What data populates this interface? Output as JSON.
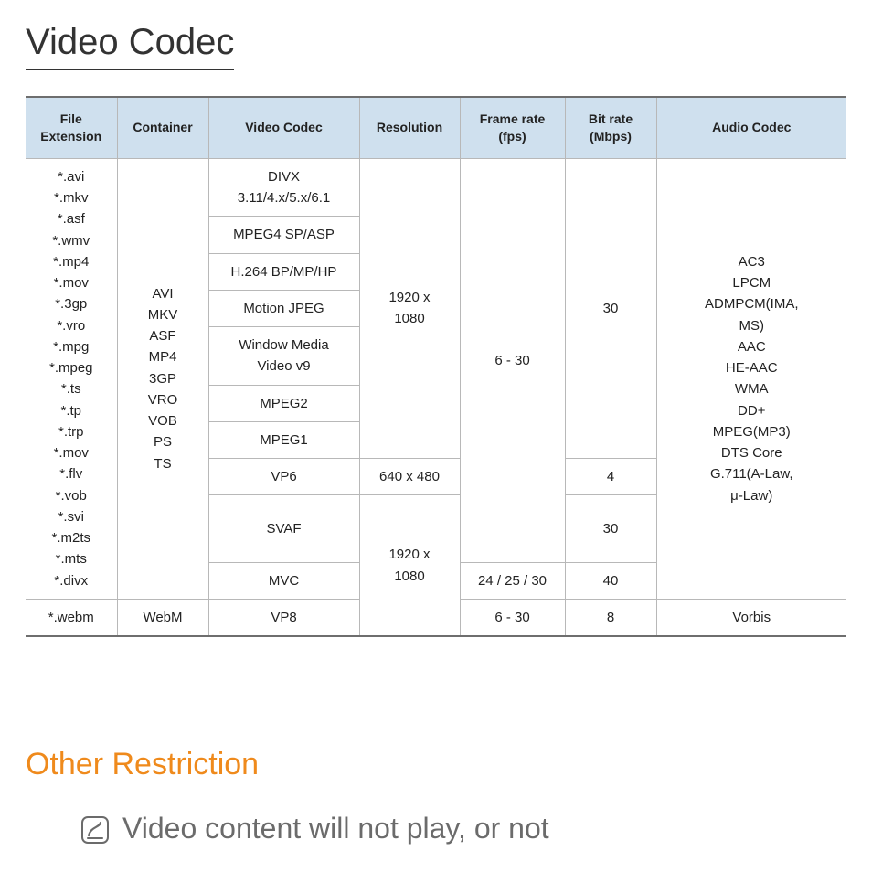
{
  "title": "Video Codec",
  "headers": {
    "ext": "File\nExtension",
    "container": "Container",
    "vcodec": "Video Codec",
    "resolution": "Resolution",
    "fps": "Frame rate\n(fps)",
    "bitrate": "Bit rate\n(Mbps)",
    "acodec": "Audio Codec"
  },
  "extensions": "*.avi\n*.mkv\n*.asf\n*.wmv\n*.mp4\n*.mov\n*.3gp\n*.vro\n*.mpg\n*.mpeg\n*.ts\n*.tp\n*.trp\n*.mov\n*.flv\n*.vob\n*.svi\n*.m2ts\n*.mts\n*.divx",
  "containers": "AVI\nMKV\nASF\nMP4\n3GP\nVRO\nVOB\nPS\nTS",
  "vcodecs": {
    "v0": "DIVX\n3.11/4.x/5.x/6.1",
    "v1": "MPEG4 SP/ASP",
    "v2": "H.264 BP/MP/HP",
    "v3": "Motion JPEG",
    "v4": "Window Media\nVideo v9",
    "v5": "MPEG2",
    "v6": "MPEG1",
    "v7": "VP6",
    "v8": "SVAF",
    "v9": "MVC"
  },
  "res": {
    "r0": "1920 x\n1080",
    "r1": "640 x 480",
    "r2": "1920 x\n1080"
  },
  "fps": {
    "f0": "6 - 30",
    "f1": "24 / 25 / 30",
    "f2": "6 - 30"
  },
  "bitrate": {
    "b0": "30",
    "b1": "4",
    "b2": "30",
    "b3": "40",
    "b4": "8"
  },
  "acodec_main": "AC3\nLPCM\nADMPCM(IMA,\nMS)\nAAC\nHE-AAC\nWMA\nDD+\nMPEG(MP3)\nDTS Core\nG.711(A-Law,\nμ-Law)",
  "webm": {
    "ext": "*.webm",
    "container": "WebM",
    "vcodec": "VP8",
    "acodec": "Vorbis"
  },
  "restriction_heading": "Other Restriction",
  "restriction_note": "Video content will not play, or not"
}
